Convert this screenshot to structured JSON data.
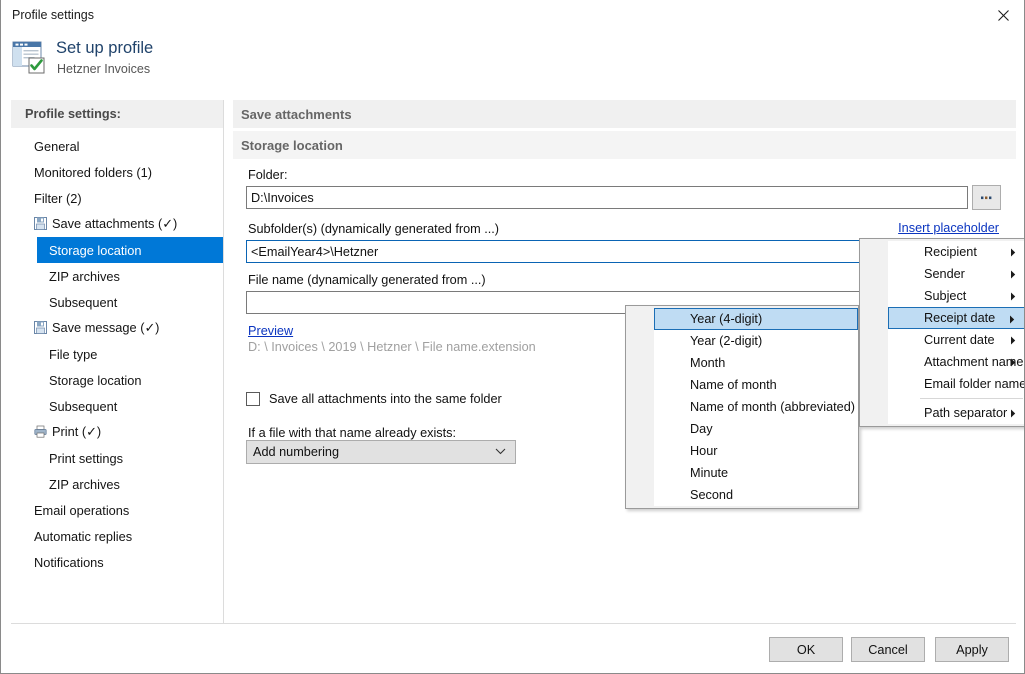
{
  "window": {
    "title": "Profile settings",
    "close_icon": "close-icon"
  },
  "header": {
    "title": "Set up profile",
    "subtitle": "Hetzner Invoices",
    "icon": "profile-window-check-icon"
  },
  "sidebar": {
    "header": "Profile settings:",
    "items": [
      {
        "label": "General",
        "level": 0,
        "icon": null,
        "selected": false
      },
      {
        "label": "Monitored folders (1)",
        "level": 0,
        "icon": null,
        "selected": false
      },
      {
        "label": "Filter (2)",
        "level": 0,
        "icon": null,
        "selected": false
      },
      {
        "label": "Save attachments (✓)",
        "level": 0,
        "icon": "save-icon",
        "selected": false
      },
      {
        "label": "Storage location",
        "level": 1,
        "icon": null,
        "selected": true
      },
      {
        "label": "ZIP archives",
        "level": 1,
        "icon": null,
        "selected": false
      },
      {
        "label": "Subsequent",
        "level": 1,
        "icon": null,
        "selected": false
      },
      {
        "label": "Save message (✓)",
        "level": 0,
        "icon": "save-icon",
        "selected": false
      },
      {
        "label": "File type",
        "level": 1,
        "icon": null,
        "selected": false
      },
      {
        "label": "Storage location",
        "level": 1,
        "icon": null,
        "selected": false
      },
      {
        "label": "Subsequent",
        "level": 1,
        "icon": null,
        "selected": false
      },
      {
        "label": "Print  (✓)",
        "level": 0,
        "icon": "printer-icon",
        "selected": false
      },
      {
        "label": "Print settings",
        "level": 1,
        "icon": null,
        "selected": false
      },
      {
        "label": "ZIP archives",
        "level": 1,
        "icon": null,
        "selected": false
      },
      {
        "label": "Email operations",
        "level": 0,
        "icon": null,
        "selected": false
      },
      {
        "label": "Automatic replies",
        "level": 0,
        "icon": null,
        "selected": false
      },
      {
        "label": "Notifications",
        "level": 0,
        "icon": null,
        "selected": false
      }
    ]
  },
  "main": {
    "section_title": "Save attachments",
    "subsection_title": "Storage location",
    "folder_label": "Folder:",
    "folder_value": "D:\\Invoices",
    "folder_placeholder": "",
    "browse_label": "...",
    "subfolder_label": "Subfolder(s) (dynamically generated from ...)",
    "subfolder_value": "<EmailYear4>\\Hetzner",
    "subfolder_placeholder": "",
    "insert_placeholder_link": "Insert placeholder",
    "filename_label": "File name (dynamically generated from ...)",
    "filename_value": "",
    "filename_placeholder": "",
    "preview_link": "Preview",
    "preview_path": "D: \\ Invoices \\ 2019 \\ Hetzner \\ File name.extension",
    "same_folder_checkbox_label": "Save all attachments into the same folder",
    "same_folder_checked": false,
    "exists_label": "If a file with that name already exists:",
    "exists_value": "Add numbering",
    "exists_options": [
      "Add numbering"
    ]
  },
  "placeholder_menu": {
    "items": [
      {
        "label": "Recipient",
        "submenu": true,
        "highlight": false,
        "separator_before": false
      },
      {
        "label": "Sender",
        "submenu": true,
        "highlight": false,
        "separator_before": false
      },
      {
        "label": "Subject",
        "submenu": true,
        "highlight": false,
        "separator_before": false
      },
      {
        "label": "Receipt date",
        "submenu": true,
        "highlight": true,
        "separator_before": false
      },
      {
        "label": "Current date",
        "submenu": true,
        "highlight": false,
        "separator_before": false
      },
      {
        "label": "Attachment name",
        "submenu": true,
        "highlight": false,
        "separator_before": false
      },
      {
        "label": "Email folder name",
        "submenu": false,
        "highlight": false,
        "separator_before": false
      },
      {
        "label": "Path separator",
        "submenu": true,
        "highlight": false,
        "separator_before": true
      }
    ]
  },
  "receipt_date_submenu": {
    "items": [
      {
        "label": "Year (4-digit)",
        "highlight": true
      },
      {
        "label": "Year (2-digit)",
        "highlight": false
      },
      {
        "label": "Month",
        "highlight": false
      },
      {
        "label": "Name of month",
        "highlight": false
      },
      {
        "label": "Name of month (abbreviated)",
        "highlight": false
      },
      {
        "label": "Day",
        "highlight": false
      },
      {
        "label": "Hour",
        "highlight": false
      },
      {
        "label": "Minute",
        "highlight": false
      },
      {
        "label": "Second",
        "highlight": false
      }
    ]
  },
  "footer": {
    "ok": "OK",
    "cancel": "Cancel",
    "apply": "Apply"
  },
  "colors": {
    "accent": "#0078d7",
    "menu_highlight": "#bfdcf3",
    "menu_highlight_border": "#1b6eb5",
    "link": "#0b35c0",
    "header_title": "#20436b",
    "pane_header_bg": "#f0f0f0"
  }
}
